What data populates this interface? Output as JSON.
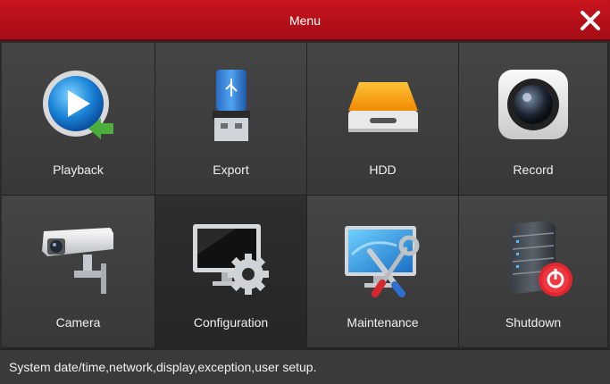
{
  "window": {
    "title": "Menu",
    "close_icon": "close-icon",
    "accent_color": "#b8111a"
  },
  "menu": {
    "items": [
      {
        "label": "Playback",
        "icon": "playback-icon"
      },
      {
        "label": "Export",
        "icon": "usb-drive-icon"
      },
      {
        "label": "HDD",
        "icon": "hard-drive-icon"
      },
      {
        "label": "Record",
        "icon": "camera-lens-icon"
      },
      {
        "label": "Camera",
        "icon": "security-camera-icon"
      },
      {
        "label": "Configuration",
        "icon": "monitor-gear-icon",
        "selected": true
      },
      {
        "label": "Maintenance",
        "icon": "monitor-tools-icon"
      },
      {
        "label": "Shutdown",
        "icon": "server-power-icon"
      }
    ]
  },
  "status": {
    "text": "System date/time,network,display,exception,user setup."
  }
}
